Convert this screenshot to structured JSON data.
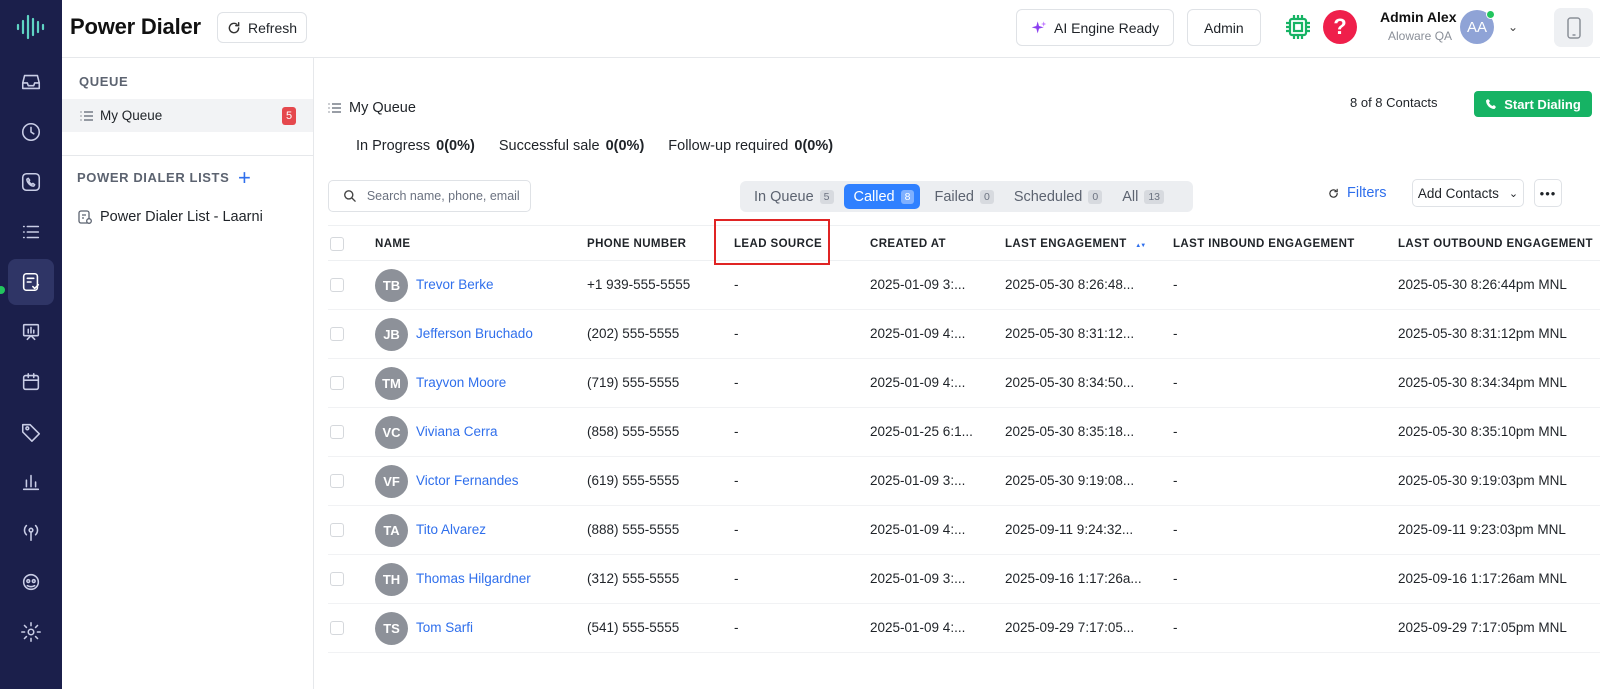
{
  "header": {
    "title": "Power Dialer",
    "refresh_label": "Refresh",
    "ai_label": "AI Engine Ready",
    "admin_label": "Admin",
    "help_glyph": "?",
    "user_name": "Admin Alex",
    "user_org": "Aloware QA",
    "user_initials": "AA"
  },
  "sidebar": {
    "queue_label": "QUEUE",
    "my_queue_label": "My Queue",
    "my_queue_count": "5",
    "lists_label": "POWER DIALER LISTS",
    "plus_glyph": "+",
    "list_item": "Power Dialer List - Laarni"
  },
  "main": {
    "crumb": "My Queue",
    "contacts_count": "8 of 8 Contacts",
    "start_label": "Start Dialing",
    "stats": [
      {
        "label": "In Progress",
        "value": "0(0%)"
      },
      {
        "label": "Successful sale",
        "value": "0(0%)"
      },
      {
        "label": "Follow-up required",
        "value": "0(0%)"
      }
    ],
    "search_placeholder": "Search name, phone, email",
    "tabs": [
      {
        "label": "In Queue",
        "count": "5"
      },
      {
        "label": "Called",
        "count": "8"
      },
      {
        "label": "Failed",
        "count": "0"
      },
      {
        "label": "Scheduled",
        "count": "0"
      },
      {
        "label": "All",
        "count": "13"
      }
    ],
    "filters_label": "Filters",
    "add_contacts_label": "Add Contacts",
    "more_glyph": "•••"
  },
  "table": {
    "columns": [
      "NAME",
      "PHONE NUMBER",
      "LEAD SOURCE",
      "CREATED AT",
      "LAST ENGAGEMENT",
      "LAST INBOUND ENGAGEMENT",
      "LAST OUTBOUND ENGAGEMENT"
    ],
    "sort_glyph": "▲▼",
    "rows": [
      {
        "initials": "TB",
        "name": "Trevor Berke",
        "phone": "+1 939-555-5555",
        "lead": "-",
        "created": "2025-01-09 3:...",
        "last": "2025-05-30 8:26:48...",
        "inbound": "-",
        "outbound": "2025-05-30 8:26:44pm MNL"
      },
      {
        "initials": "JB",
        "name": "Jefferson Bruchado",
        "phone": "(202) 555-5555",
        "lead": "-",
        "created": "2025-01-09 4:...",
        "last": "2025-05-30 8:31:12...",
        "inbound": "-",
        "outbound": "2025-05-30 8:31:12pm MNL"
      },
      {
        "initials": "TM",
        "name": "Trayvon Moore",
        "phone": "(719) 555-5555",
        "lead": "-",
        "created": "2025-01-09 4:...",
        "last": "2025-05-30 8:34:50...",
        "inbound": "-",
        "outbound": "2025-05-30 8:34:34pm MNL"
      },
      {
        "initials": "VC",
        "name": "Viviana Cerra",
        "phone": "(858) 555-5555",
        "lead": "-",
        "created": "2025-01-25 6:1...",
        "last": "2025-05-30 8:35:18...",
        "inbound": "-",
        "outbound": "2025-05-30 8:35:10pm MNL"
      },
      {
        "initials": "VF",
        "name": "Victor Fernandes",
        "phone": "(619) 555-5555",
        "lead": "-",
        "created": "2025-01-09 3:...",
        "last": "2025-05-30 9:19:08...",
        "inbound": "-",
        "outbound": "2025-05-30 9:19:03pm MNL"
      },
      {
        "initials": "TA",
        "name": "Tito Alvarez",
        "phone": "(888) 555-5555",
        "lead": "-",
        "created": "2025-01-09 4:...",
        "last": "2025-09-11 9:24:32...",
        "inbound": "-",
        "outbound": "2025-09-11 9:23:03pm MNL"
      },
      {
        "initials": "TH",
        "name": "Thomas Hilgardner",
        "phone": "(312) 555-5555",
        "lead": "-",
        "created": "2025-01-09 3:...",
        "last": "2025-09-16 1:17:26a...",
        "inbound": "-",
        "outbound": "2025-09-16 1:17:26am MNL"
      },
      {
        "initials": "TS",
        "name": "Tom Sarfi",
        "phone": "(541) 555-5555",
        "lead": "-",
        "created": "2025-01-09 4:...",
        "last": "2025-09-29 7:17:05...",
        "inbound": "-",
        "outbound": "2025-09-29 7:17:05pm MNL"
      }
    ]
  },
  "colors": {
    "rail": "#1b1f4b",
    "accent": "#2f80ff",
    "start": "#16b364",
    "highlight": "#e02424"
  }
}
